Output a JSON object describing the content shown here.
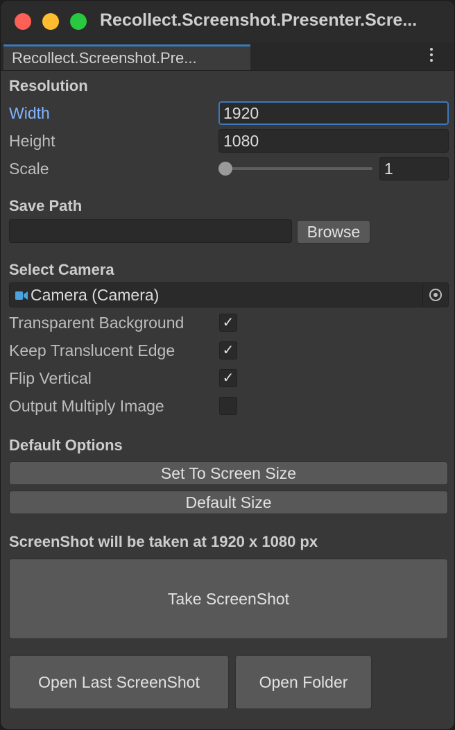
{
  "window": {
    "title": "Recollect.Screenshot.Presenter.Scre...",
    "tab_label": "Recollect.Screenshot.Pre...",
    "icons": [
      "close-button",
      "minimize-button",
      "maximize-button",
      "kebab-menu-icon"
    ]
  },
  "resolution": {
    "heading": "Resolution",
    "width_label": "Width",
    "width_value": "1920",
    "height_label": "Height",
    "height_value": "1080",
    "scale_label": "Scale",
    "scale_value": "1"
  },
  "save_path": {
    "heading": "Save Path",
    "value": "",
    "browse_label": "Browse"
  },
  "camera": {
    "heading": "Select Camera",
    "value": "Camera (Camera)",
    "icon": "camera-icon",
    "picker_icon": "object-picker-icon"
  },
  "options": [
    {
      "label": "Transparent Background",
      "checked": true
    },
    {
      "label": "Keep Translucent Edge",
      "checked": true
    },
    {
      "label": "Flip Vertical",
      "checked": true
    },
    {
      "label": "Output Multiply Image",
      "checked": false
    }
  ],
  "default_options": {
    "heading": "Default Options",
    "set_screen_size_label": "Set To Screen Size",
    "default_size_label": "Default Size"
  },
  "screenshot": {
    "status": "ScreenShot will be taken at 1920 x 1080 px",
    "take_label": "Take ScreenShot",
    "open_last_label": "Open Last ScreenShot",
    "open_folder_label": "Open Folder"
  },
  "colors": {
    "accent": "#3a79bb",
    "active_label": "#80b4ff",
    "background": "#383838"
  }
}
